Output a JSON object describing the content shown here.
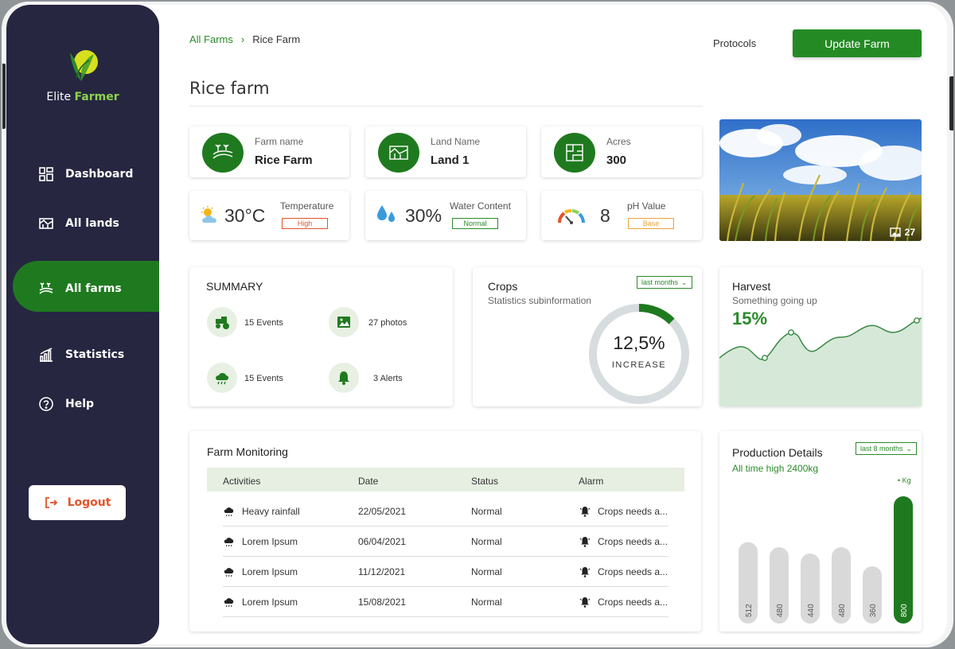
{
  "brand": {
    "name_part1": "Elite",
    "name_part2": "Farmer"
  },
  "nav": [
    {
      "label": "Dashboard",
      "icon": "dashboard-icon"
    },
    {
      "label": "All lands",
      "icon": "lands-icon"
    },
    {
      "label": "All farms",
      "icon": "farms-icon",
      "active": true
    },
    {
      "label": "Statistics",
      "icon": "statistics-icon"
    },
    {
      "label": "Help",
      "icon": "help-icon"
    }
  ],
  "logout_label": "Logout",
  "breadcrumb": {
    "root": "All Farms",
    "current": "Rice Farm"
  },
  "header": {
    "protocols": "Protocols",
    "update_button": "Update Farm",
    "title": "Rice farm"
  },
  "info_cards": [
    {
      "label": "Farm name",
      "value": "Rice Farm"
    },
    {
      "label": "Land Name",
      "value": "Land 1"
    },
    {
      "label": "Acres",
      "value": "300"
    }
  ],
  "metrics": [
    {
      "value": "30°C",
      "label": "Temperature",
      "tag": "High",
      "tag_color": "#e2542a"
    },
    {
      "value": "30%",
      "label": "Water Content",
      "tag": "Normal",
      "tag_color": "#2b8a2b"
    },
    {
      "value": "8",
      "label": "pH Value",
      "tag": "Base",
      "tag_color": "#e8a33a"
    }
  ],
  "photo": {
    "count": "27"
  },
  "summary": {
    "title": "SUMMARY",
    "items": [
      {
        "text": "15 Events",
        "icon": "tractor-icon"
      },
      {
        "text": "27 photos",
        "icon": "photos-icon"
      },
      {
        "text": "15 Events",
        "icon": "rain-cloud-icon"
      },
      {
        "text": "3 Alerts",
        "icon": "bell-icon"
      }
    ]
  },
  "crops": {
    "title": "Crops",
    "subtitle": "Statistics subinformation",
    "dropdown": "last months",
    "value": "12,5%",
    "value_label": "INCREASE",
    "progress": 0.125
  },
  "harvest": {
    "title": "Harvest",
    "subtitle": "Something going up",
    "value": "15%"
  },
  "monitoring": {
    "title": "Farm Monitoring",
    "columns": [
      "Activities",
      "Date",
      "Status",
      "Alarm"
    ],
    "rows": [
      {
        "activity": "Heavy rainfall",
        "date": "22/05/2021",
        "status": "Normal",
        "alarm": "Crops needs a..."
      },
      {
        "activity": "Lorem Ipsum",
        "date": "06/04/2021",
        "status": "Normal",
        "alarm": "Crops needs a..."
      },
      {
        "activity": "Lorem Ipsum",
        "date": "11/12/2021",
        "status": "Normal",
        "alarm": "Crops needs a..."
      },
      {
        "activity": "Lorem Ipsum",
        "date": "15/08/2021",
        "status": "Normal",
        "alarm": "Crops needs a..."
      }
    ]
  },
  "production": {
    "title": "Production Details",
    "subtitle": "All time high 2400kg",
    "dropdown": "last 8 months",
    "legend": "Kg"
  },
  "chart_data": {
    "type": "bar",
    "title": "Production Details",
    "values": [
      512,
      480,
      440,
      480,
      360,
      800
    ],
    "series": [
      {
        "name": "Kg",
        "values": [
          512,
          480,
          440,
          480,
          360,
          800
        ]
      }
    ],
    "highlight_index": 5,
    "colors": {
      "default": "#d9d9d9",
      "highlight": "#1f7a1f"
    }
  },
  "colors": {
    "sidebar": "#262641",
    "accent": "#1f7a1f",
    "brand_green": "#8fd14f"
  }
}
